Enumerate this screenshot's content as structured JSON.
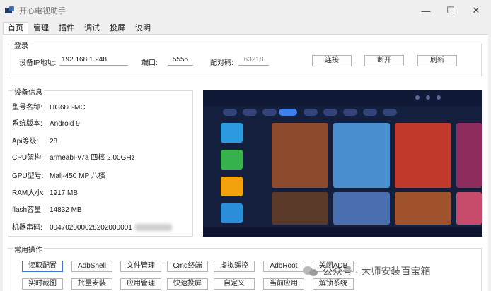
{
  "window": {
    "title": "开心电视助手",
    "minimize_symbol": "—",
    "maximize_symbol": "☐",
    "close_symbol": "✕"
  },
  "tabs": [
    "首页",
    "管理",
    "插件",
    "调试",
    "投屏",
    "说明"
  ],
  "login": {
    "group_title": "登录",
    "ip_label": "设备IP地址:",
    "ip_value": "192.168.1.248",
    "port_label": "端口:",
    "port_value": "5555",
    "pair_label": "配对码:",
    "pair_value": "63218",
    "connect_label": "连接",
    "disconnect_label": "断开",
    "refresh_label": "刷新"
  },
  "device_info": {
    "group_title": "设备信息",
    "rows": [
      {
        "label": "型号名称:",
        "value": "HG680-MC"
      },
      {
        "label": "系统版本:",
        "value": "Android 9"
      },
      {
        "label": "Api等级:",
        "value": "28"
      },
      {
        "label": "CPU架构:",
        "value": "armeabi-v7a 四核 2.00GHz"
      },
      {
        "label": "GPU型号:",
        "value": "Mali-450 MP 八核"
      },
      {
        "label": "RAM大小:",
        "value": "1917 MB"
      },
      {
        "label": "flash容量:",
        "value": "14832 MB"
      },
      {
        "label": "机器串码:",
        "value": "004702000028202000001"
      }
    ]
  },
  "common_ops": {
    "group_title": "常用操作",
    "row1": [
      "读取配置",
      "AdbShell",
      "文件管理",
      "Cmd终端",
      "虚拟遥控",
      "AdbRoot",
      "关闭ADB"
    ],
    "row2": [
      "实时截图",
      "批量安装",
      "应用管理",
      "快速投屏",
      "自定义",
      "当前应用",
      "解锁系统"
    ]
  },
  "screen_preview": {
    "colors": [
      "#141f3d",
      "#3e7ff0",
      "#2d9be0",
      "#37b24d",
      "#f2a20c",
      "#2a8fd8",
      "#c0392b",
      "#8e2c5e",
      "#4a6fb0"
    ]
  },
  "watermark": {
    "text": "公众号 · 大师安装百宝箱"
  }
}
